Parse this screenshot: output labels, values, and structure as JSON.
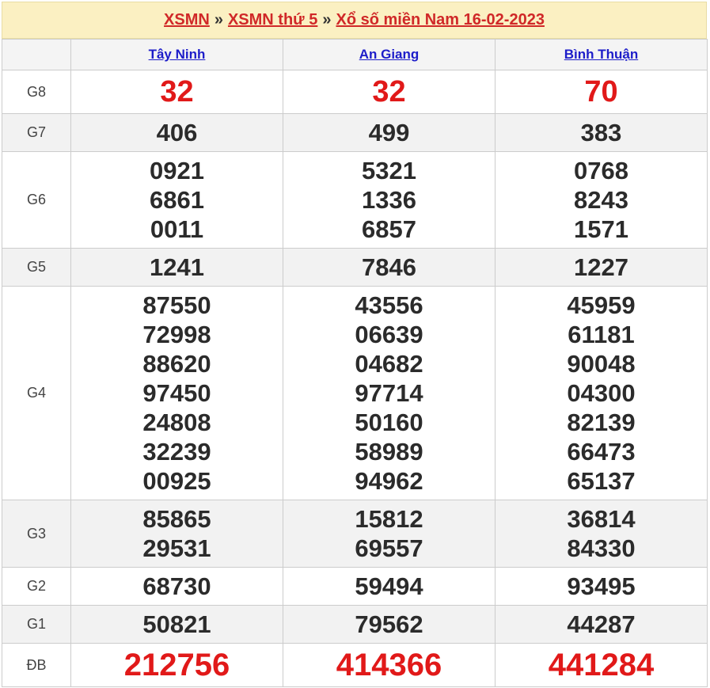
{
  "breadcrumb": {
    "link1": "XSMN",
    "link2": "XSMN thứ 5",
    "link3": "Xổ số miền Nam 16-02-2023",
    "sep": "»"
  },
  "provinces": [
    "Tây Ninh",
    "An Giang",
    "Bình Thuận"
  ],
  "prizes": [
    {
      "label": "G8",
      "values": [
        [
          "32"
        ],
        [
          "32"
        ],
        [
          "70"
        ]
      ]
    },
    {
      "label": "G7",
      "values": [
        [
          "406"
        ],
        [
          "499"
        ],
        [
          "383"
        ]
      ]
    },
    {
      "label": "G6",
      "values": [
        [
          "0921",
          "6861",
          "0011"
        ],
        [
          "5321",
          "1336",
          "6857"
        ],
        [
          "0768",
          "8243",
          "1571"
        ]
      ]
    },
    {
      "label": "G5",
      "values": [
        [
          "1241"
        ],
        [
          "7846"
        ],
        [
          "1227"
        ]
      ]
    },
    {
      "label": "G4",
      "values": [
        [
          "87550",
          "72998",
          "88620",
          "97450",
          "24808",
          "32239",
          "00925"
        ],
        [
          "43556",
          "06639",
          "04682",
          "97714",
          "50160",
          "58989",
          "94962"
        ],
        [
          "45959",
          "61181",
          "90048",
          "04300",
          "82139",
          "66473",
          "65137"
        ]
      ]
    },
    {
      "label": "G3",
      "values": [
        [
          "85865",
          "29531"
        ],
        [
          "15812",
          "69557"
        ],
        [
          "36814",
          "84330"
        ]
      ]
    },
    {
      "label": "G2",
      "values": [
        [
          "68730"
        ],
        [
          "59494"
        ],
        [
          "93495"
        ]
      ]
    },
    {
      "label": "G1",
      "values": [
        [
          "50821"
        ],
        [
          "79562"
        ],
        [
          "44287"
        ]
      ]
    },
    {
      "label": "ĐB",
      "values": [
        [
          "212756"
        ],
        [
          "414366"
        ],
        [
          "441284"
        ]
      ]
    }
  ],
  "colors": {
    "red": "#e11919",
    "link": "#1d1dc9",
    "header_bg": "#fbf0c2"
  }
}
